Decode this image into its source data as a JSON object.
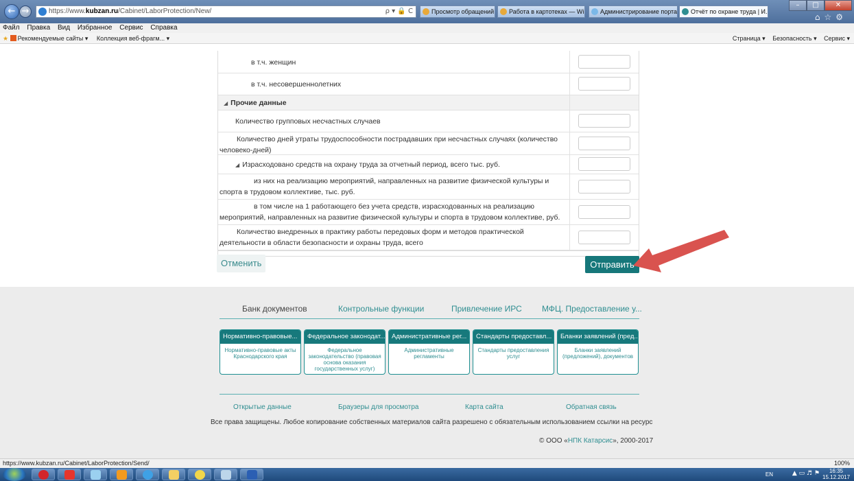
{
  "browser": {
    "url_prefix": "https://www.",
    "url_host": "kubzan.ru",
    "url_path": "/Cabinet/LaborProtection/New/",
    "address_tools": "ρ ▾ 🔒 C",
    "tabs": [
      {
        "label": "Просмотр обращений - Цент..."
      },
      {
        "label": "Работа в картотеках — Wiki"
      },
      {
        "label": "Администрирование портала..."
      },
      {
        "label": "Отчёт по охране труда | И...",
        "close": "×"
      }
    ],
    "menu": [
      "Файл",
      "Правка",
      "Вид",
      "Избранное",
      "Сервис",
      "Справка"
    ],
    "favorites": [
      "Рекомендуемые сайты ▾",
      "Коллекция веб-фрагм... ▾"
    ],
    "commands": [
      "Страница ▾",
      "Безопасность ▾",
      "Сервис ▾"
    ],
    "status_url": "https://www.kubzan.ru/Cabinet/LaborProtection/Send/",
    "zoom": "100%"
  },
  "form": {
    "rows": [
      {
        "label": "в т.ч. женщин",
        "type": "field",
        "level": 2
      },
      {
        "label": "в т.ч. несовершеннолетних",
        "type": "field",
        "level": 2
      },
      {
        "label": "Прочие данные",
        "type": "section",
        "level": 0
      },
      {
        "label": "Количество групповых несчастных случаев",
        "type": "field",
        "level": 1
      },
      {
        "label": "Количество дней утраты трудоспособности пострадавших при несчастных случаях (количество человеко-дней)",
        "type": "field",
        "level": 1,
        "wrap": true
      },
      {
        "label": "Израсходовано средств на охрану труда за отчетный период, всего тыс. руб.",
        "type": "field",
        "level": 1,
        "caret": true
      },
      {
        "label": "из них на реализацию мероприятий, направленных на развитие физической культуры и спорта в трудовом коллективе, тыс. руб.",
        "type": "field",
        "level": 2,
        "wrap": true
      },
      {
        "label": "в том числе на 1 работающего без учета средств, израсходованных на реализацию мероприятий, направленных на развитие физической культуры и спорта в трудовом коллективе, руб.",
        "type": "field",
        "level": 2,
        "wrap": true
      },
      {
        "label": "Количество внедренных в практику работы передовых форм и методов практической деятельности в области безопасности и охраны труда, всего",
        "type": "field",
        "level": 1,
        "wrap": true
      }
    ],
    "cancel_label": "Отменить",
    "submit_label": "Отправить"
  },
  "footer": {
    "nav": [
      "Банк документов",
      "Контрольные функции",
      "Привлечение ИРС",
      "МФЦ. Предоставление у..."
    ],
    "cards": [
      {
        "title": "Нормативно-правовые...",
        "body": "Нормативно-правовые акты Краснодарского края"
      },
      {
        "title": "Федеральное законодат...",
        "body": "Федеральное законодательство (правовая основа оказания государственных услуг)"
      },
      {
        "title": "Административные рег...",
        "body": "Административные регламенты"
      },
      {
        "title": "Стандарты предоставл...",
        "body": "Стандарты предоставления услуг"
      },
      {
        "title": "Бланки заявлений (пред...",
        "body": "Бланки заявлений (предложений), документов"
      }
    ],
    "links": [
      "Открытые данные",
      "Браузеры для просмотра",
      "Карта сайта",
      "Обратная связь"
    ],
    "rights": "Все права защищены. Любое копирование собственных материалов сайта разрешено с обязательным использованием ссылки на ресурс",
    "copyright_prefix": "© ООО «",
    "copyright_link": "НПК Катарсис",
    "copyright_suffix": "», 2000-2017"
  },
  "taskbar": {
    "lang": "EN",
    "time": "16:35",
    "date": "15.12.2017"
  },
  "colors": {
    "accent": "#16777a",
    "link": "#2f8e91",
    "arrow": "#d9534f"
  }
}
